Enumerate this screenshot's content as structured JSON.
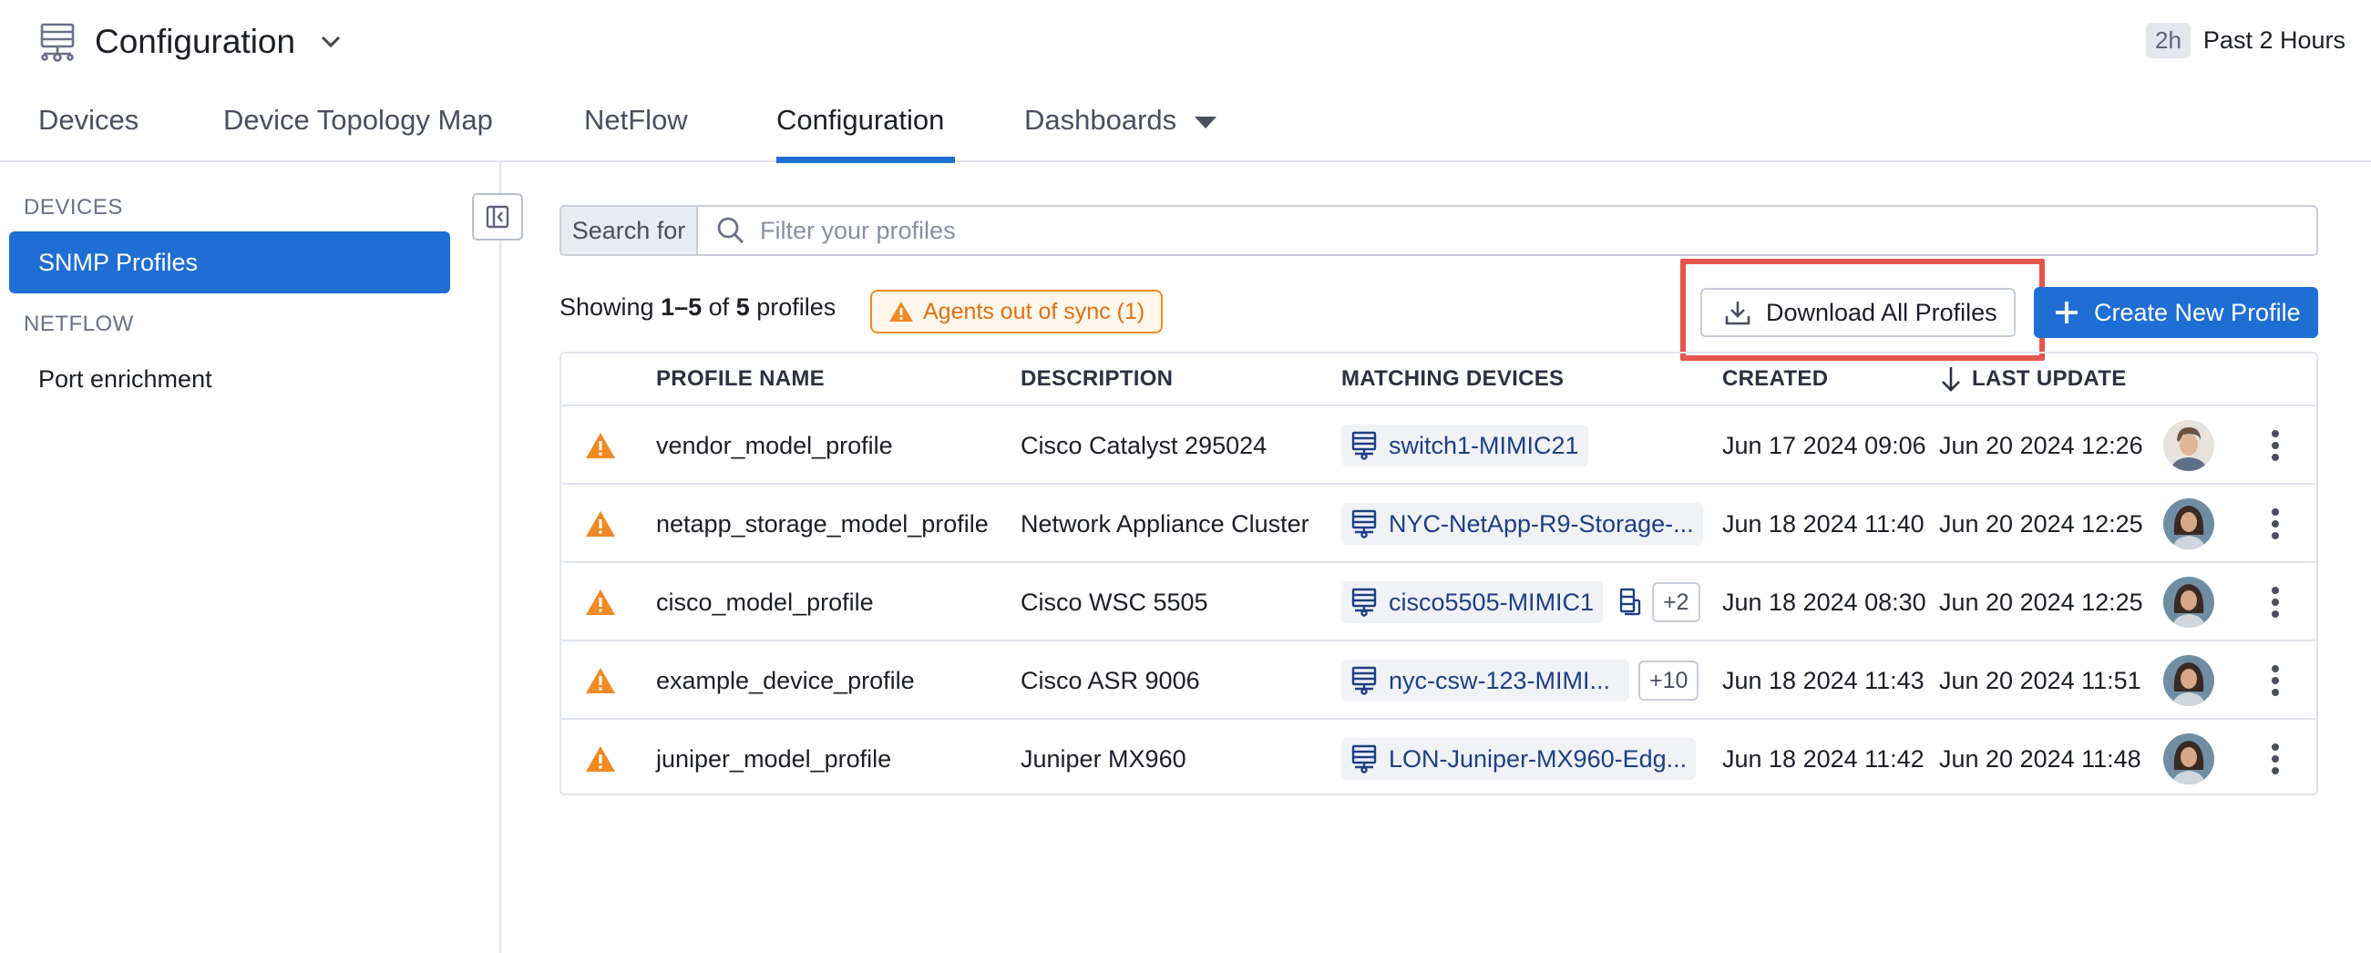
{
  "header": {
    "title": "Configuration",
    "title_icon": "network-device-icon",
    "timeframe_badge": "2h",
    "timeframe_label": "Past 2 Hours"
  },
  "tabs": [
    {
      "label": "Devices",
      "active": false
    },
    {
      "label": "Device Topology Map",
      "active": false
    },
    {
      "label": "NetFlow",
      "active": false
    },
    {
      "label": "Configuration",
      "active": true
    },
    {
      "label": "Dashboards",
      "active": false
    }
  ],
  "sidebar": {
    "sections": [
      {
        "heading": "DEVICES",
        "items": [
          {
            "label": "SNMP Profiles",
            "active": true
          }
        ]
      },
      {
        "heading": "NETFLOW",
        "items": [
          {
            "label": "Port enrichment",
            "active": false
          }
        ]
      }
    ]
  },
  "search": {
    "label": "Search for",
    "placeholder": "Filter your profiles",
    "value": ""
  },
  "toolbar": {
    "showing_prefix": "Showing ",
    "showing_range": "1–5",
    "showing_of": " of ",
    "showing_total": "5",
    "showing_suffix": " profiles",
    "sync_badge": "Agents out of sync (1)",
    "download_label": "Download All Profiles",
    "create_label": "Create New Profile"
  },
  "table": {
    "columns": [
      "PROFILE NAME",
      "DESCRIPTION",
      "MATCHING DEVICES",
      "CREATED",
      "LAST UPDATE"
    ],
    "sort_column": "LAST UPDATE",
    "sort_direction": "descending",
    "rows": [
      {
        "name": "vendor_model_profile",
        "description": "Cisco Catalyst 295024",
        "device": "switch1-MIMIC21",
        "extra_device": false,
        "more": "",
        "created": "Jun 17 2024 09:06",
        "updated": "Jun 20 2024 12:26",
        "avatar": "avatar-man"
      },
      {
        "name": "netapp_storage_model_profile",
        "description": "Network Appliance Cluster",
        "device": "NYC-NetApp-R9-Storage-...",
        "extra_device": false,
        "more": "",
        "created": "Jun 18 2024 11:40",
        "updated": "Jun 20 2024 12:25",
        "avatar": "avatar-woman"
      },
      {
        "name": "cisco_model_profile",
        "description": "Cisco WSC 5505",
        "device": "cisco5505-MIMIC1",
        "extra_device": true,
        "more": "+2",
        "created": "Jun 18 2024 08:30",
        "updated": "Jun 20 2024 12:25",
        "avatar": "avatar-woman"
      },
      {
        "name": "example_device_profile",
        "description": "Cisco ASR 9006",
        "device": "nyc-csw-123-MIMI...",
        "extra_device": false,
        "more": "+10",
        "created": "Jun 18 2024 11:43",
        "updated": "Jun 20 2024 11:51",
        "avatar": "avatar-woman"
      },
      {
        "name": "juniper_model_profile",
        "description": "Juniper MX960",
        "device": "LON-Juniper-MX960-Edg...",
        "extra_device": false,
        "more": "",
        "created": "Jun 18 2024 11:42",
        "updated": "Jun 20 2024 11:48",
        "avatar": "avatar-woman"
      }
    ]
  },
  "colors": {
    "accent": "#1f6ed4",
    "warning": "#f08a24",
    "highlight": "#e4564c",
    "device_link": "#1d3f84"
  }
}
